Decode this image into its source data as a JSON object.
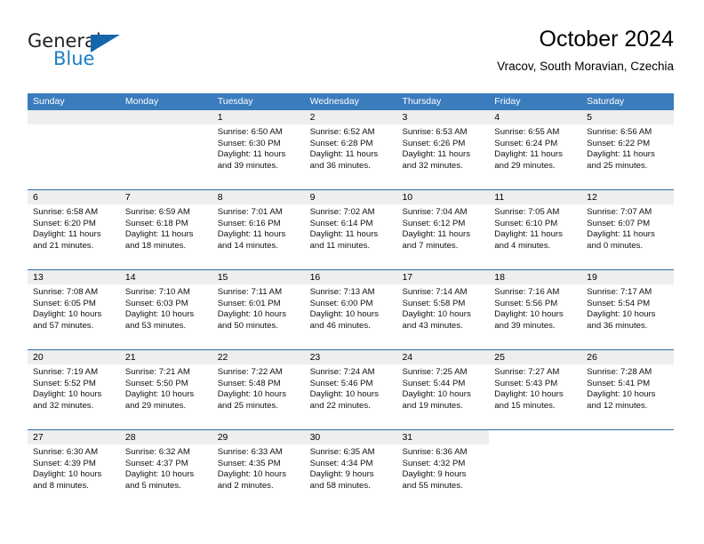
{
  "brand": {
    "name_primary": "General",
    "name_secondary": "Blue",
    "logo_icon": "triangle-logo-icon"
  },
  "header": {
    "title": "October 2024",
    "subtitle": "Vracov, South Moravian, Czechia"
  },
  "colors": {
    "header_blue": "#3b7cbd",
    "row_divider_blue": "#2f6ca8",
    "daynum_band": "#eeeeee",
    "logo_blue": "#1b7fc4"
  },
  "weekdays": [
    "Sunday",
    "Monday",
    "Tuesday",
    "Wednesday",
    "Thursday",
    "Friday",
    "Saturday"
  ],
  "labels": {
    "sunrise_prefix": "Sunrise:",
    "sunset_prefix": "Sunset:",
    "daylight_prefix": "Daylight:"
  },
  "weeks": [
    [
      {
        "day": "",
        "empty": true
      },
      {
        "day": "",
        "empty": true
      },
      {
        "day": "1",
        "sunrise": "Sunrise: 6:50 AM",
        "sunset": "Sunset: 6:30 PM",
        "daylight_1": "Daylight: 11 hours",
        "daylight_2": "and 39 minutes."
      },
      {
        "day": "2",
        "sunrise": "Sunrise: 6:52 AM",
        "sunset": "Sunset: 6:28 PM",
        "daylight_1": "Daylight: 11 hours",
        "daylight_2": "and 36 minutes."
      },
      {
        "day": "3",
        "sunrise": "Sunrise: 6:53 AM",
        "sunset": "Sunset: 6:26 PM",
        "daylight_1": "Daylight: 11 hours",
        "daylight_2": "and 32 minutes."
      },
      {
        "day": "4",
        "sunrise": "Sunrise: 6:55 AM",
        "sunset": "Sunset: 6:24 PM",
        "daylight_1": "Daylight: 11 hours",
        "daylight_2": "and 29 minutes."
      },
      {
        "day": "5",
        "sunrise": "Sunrise: 6:56 AM",
        "sunset": "Sunset: 6:22 PM",
        "daylight_1": "Daylight: 11 hours",
        "daylight_2": "and 25 minutes."
      }
    ],
    [
      {
        "day": "6",
        "sunrise": "Sunrise: 6:58 AM",
        "sunset": "Sunset: 6:20 PM",
        "daylight_1": "Daylight: 11 hours",
        "daylight_2": "and 21 minutes."
      },
      {
        "day": "7",
        "sunrise": "Sunrise: 6:59 AM",
        "sunset": "Sunset: 6:18 PM",
        "daylight_1": "Daylight: 11 hours",
        "daylight_2": "and 18 minutes."
      },
      {
        "day": "8",
        "sunrise": "Sunrise: 7:01 AM",
        "sunset": "Sunset: 6:16 PM",
        "daylight_1": "Daylight: 11 hours",
        "daylight_2": "and 14 minutes."
      },
      {
        "day": "9",
        "sunrise": "Sunrise: 7:02 AM",
        "sunset": "Sunset: 6:14 PM",
        "daylight_1": "Daylight: 11 hours",
        "daylight_2": "and 11 minutes."
      },
      {
        "day": "10",
        "sunrise": "Sunrise: 7:04 AM",
        "sunset": "Sunset: 6:12 PM",
        "daylight_1": "Daylight: 11 hours",
        "daylight_2": "and 7 minutes."
      },
      {
        "day": "11",
        "sunrise": "Sunrise: 7:05 AM",
        "sunset": "Sunset: 6:10 PM",
        "daylight_1": "Daylight: 11 hours",
        "daylight_2": "and 4 minutes."
      },
      {
        "day": "12",
        "sunrise": "Sunrise: 7:07 AM",
        "sunset": "Sunset: 6:07 PM",
        "daylight_1": "Daylight: 11 hours",
        "daylight_2": "and 0 minutes."
      }
    ],
    [
      {
        "day": "13",
        "sunrise": "Sunrise: 7:08 AM",
        "sunset": "Sunset: 6:05 PM",
        "daylight_1": "Daylight: 10 hours",
        "daylight_2": "and 57 minutes."
      },
      {
        "day": "14",
        "sunrise": "Sunrise: 7:10 AM",
        "sunset": "Sunset: 6:03 PM",
        "daylight_1": "Daylight: 10 hours",
        "daylight_2": "and 53 minutes."
      },
      {
        "day": "15",
        "sunrise": "Sunrise: 7:11 AM",
        "sunset": "Sunset: 6:01 PM",
        "daylight_1": "Daylight: 10 hours",
        "daylight_2": "and 50 minutes."
      },
      {
        "day": "16",
        "sunrise": "Sunrise: 7:13 AM",
        "sunset": "Sunset: 6:00 PM",
        "daylight_1": "Daylight: 10 hours",
        "daylight_2": "and 46 minutes."
      },
      {
        "day": "17",
        "sunrise": "Sunrise: 7:14 AM",
        "sunset": "Sunset: 5:58 PM",
        "daylight_1": "Daylight: 10 hours",
        "daylight_2": "and 43 minutes."
      },
      {
        "day": "18",
        "sunrise": "Sunrise: 7:16 AM",
        "sunset": "Sunset: 5:56 PM",
        "daylight_1": "Daylight: 10 hours",
        "daylight_2": "and 39 minutes."
      },
      {
        "day": "19",
        "sunrise": "Sunrise: 7:17 AM",
        "sunset": "Sunset: 5:54 PM",
        "daylight_1": "Daylight: 10 hours",
        "daylight_2": "and 36 minutes."
      }
    ],
    [
      {
        "day": "20",
        "sunrise": "Sunrise: 7:19 AM",
        "sunset": "Sunset: 5:52 PM",
        "daylight_1": "Daylight: 10 hours",
        "daylight_2": "and 32 minutes."
      },
      {
        "day": "21",
        "sunrise": "Sunrise: 7:21 AM",
        "sunset": "Sunset: 5:50 PM",
        "daylight_1": "Daylight: 10 hours",
        "daylight_2": "and 29 minutes."
      },
      {
        "day": "22",
        "sunrise": "Sunrise: 7:22 AM",
        "sunset": "Sunset: 5:48 PM",
        "daylight_1": "Daylight: 10 hours",
        "daylight_2": "and 25 minutes."
      },
      {
        "day": "23",
        "sunrise": "Sunrise: 7:24 AM",
        "sunset": "Sunset: 5:46 PM",
        "daylight_1": "Daylight: 10 hours",
        "daylight_2": "and 22 minutes."
      },
      {
        "day": "24",
        "sunrise": "Sunrise: 7:25 AM",
        "sunset": "Sunset: 5:44 PM",
        "daylight_1": "Daylight: 10 hours",
        "daylight_2": "and 19 minutes."
      },
      {
        "day": "25",
        "sunrise": "Sunrise: 7:27 AM",
        "sunset": "Sunset: 5:43 PM",
        "daylight_1": "Daylight: 10 hours",
        "daylight_2": "and 15 minutes."
      },
      {
        "day": "26",
        "sunrise": "Sunrise: 7:28 AM",
        "sunset": "Sunset: 5:41 PM",
        "daylight_1": "Daylight: 10 hours",
        "daylight_2": "and 12 minutes."
      }
    ],
    [
      {
        "day": "27",
        "sunrise": "Sunrise: 6:30 AM",
        "sunset": "Sunset: 4:39 PM",
        "daylight_1": "Daylight: 10 hours",
        "daylight_2": "and 8 minutes."
      },
      {
        "day": "28",
        "sunrise": "Sunrise: 6:32 AM",
        "sunset": "Sunset: 4:37 PM",
        "daylight_1": "Daylight: 10 hours",
        "daylight_2": "and 5 minutes."
      },
      {
        "day": "29",
        "sunrise": "Sunrise: 6:33 AM",
        "sunset": "Sunset: 4:35 PM",
        "daylight_1": "Daylight: 10 hours",
        "daylight_2": "and 2 minutes."
      },
      {
        "day": "30",
        "sunrise": "Sunrise: 6:35 AM",
        "sunset": "Sunset: 4:34 PM",
        "daylight_1": "Daylight: 9 hours",
        "daylight_2": "and 58 minutes."
      },
      {
        "day": "31",
        "sunrise": "Sunrise: 6:36 AM",
        "sunset": "Sunset: 4:32 PM",
        "daylight_1": "Daylight: 9 hours",
        "daylight_2": "and 55 minutes."
      },
      {
        "day": "",
        "empty": true,
        "blank": true
      },
      {
        "day": "",
        "empty": true,
        "blank": true
      }
    ]
  ]
}
